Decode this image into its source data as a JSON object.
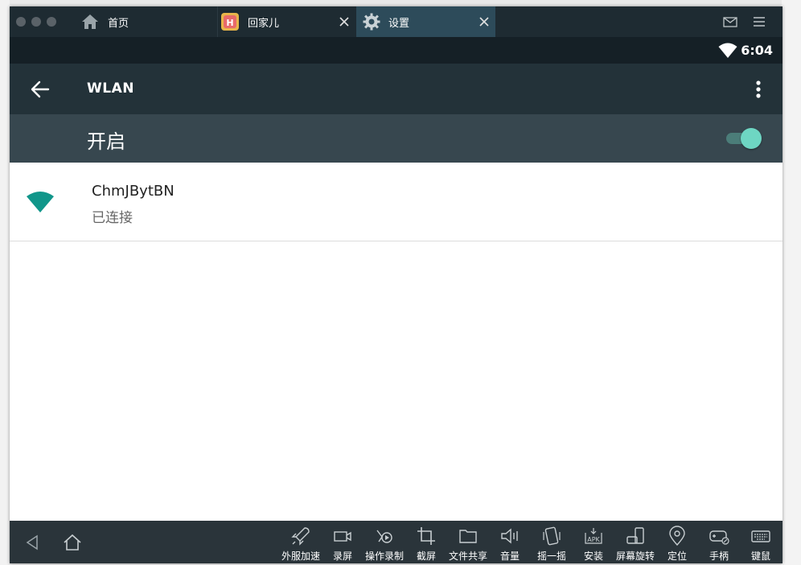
{
  "tabs": [
    {
      "label": "首页",
      "icon": "home-icon",
      "active": false
    },
    {
      "label": "回家儿",
      "icon": "app-icon",
      "active": false
    },
    {
      "label": "设置",
      "icon": "gear-icon",
      "active": true
    }
  ],
  "statusbar": {
    "time": "6:04"
  },
  "appbar": {
    "title": "WLAN"
  },
  "switch": {
    "label": "开启",
    "on": true
  },
  "network": {
    "ssid": "ChmJBytBN",
    "status": "已连接"
  },
  "toolbar": [
    {
      "label": "外服加速",
      "icon": "rocket-icon"
    },
    {
      "label": "录屏",
      "icon": "video-camera-icon"
    },
    {
      "label": "操作录制",
      "icon": "action-record-icon"
    },
    {
      "label": "截屏",
      "icon": "crop-icon"
    },
    {
      "label": "文件共享",
      "icon": "folder-icon"
    },
    {
      "label": "音量",
      "icon": "volume-icon"
    },
    {
      "label": "摇一摇",
      "icon": "shake-icon"
    },
    {
      "label": "安装",
      "icon": "apk-install-icon"
    },
    {
      "label": "屏幕旋转",
      "icon": "rotate-screen-icon"
    },
    {
      "label": "定位",
      "icon": "location-icon"
    },
    {
      "label": "手柄",
      "icon": "gamepad-icon"
    },
    {
      "label": "键鼠",
      "icon": "keyboard-icon"
    }
  ],
  "colors": {
    "accent": "#6ed6c3",
    "wifi_signal": "#11968a",
    "appbar": "#233239",
    "switchbar": "#37474f"
  }
}
